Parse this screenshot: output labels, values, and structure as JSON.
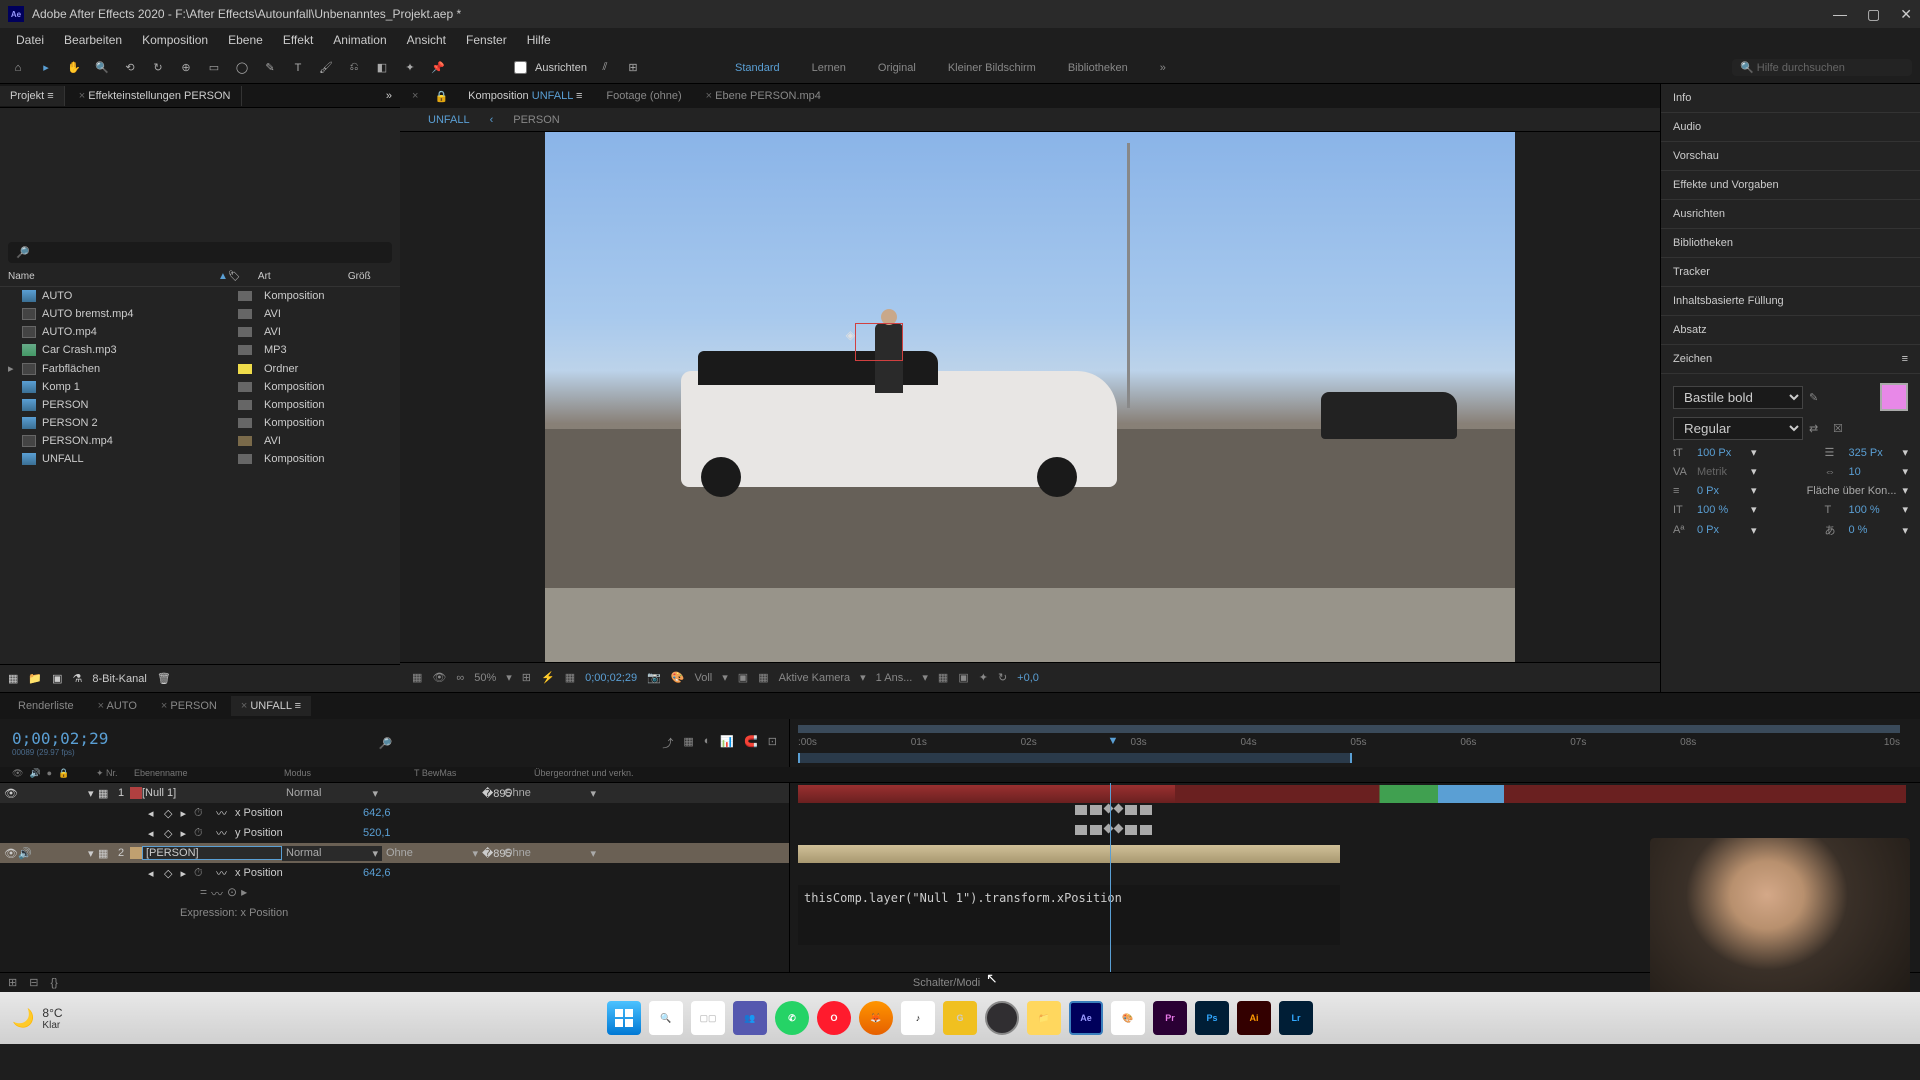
{
  "window": {
    "title": "Adobe After Effects 2020 - F:\\After Effects\\Autounfall\\Unbenanntes_Projekt.aep *"
  },
  "menu": [
    "Datei",
    "Bearbeiten",
    "Komposition",
    "Ebene",
    "Effekt",
    "Animation",
    "Ansicht",
    "Fenster",
    "Hilfe"
  ],
  "toolbar": {
    "align": "Ausrichten",
    "workspaces": [
      "Standard",
      "Lernen",
      "Original",
      "Kleiner Bildschirm",
      "Bibliotheken"
    ],
    "help_placeholder": "Hilfe durchsuchen"
  },
  "project": {
    "tab": "Projekt",
    "effect_tab": "Effekteinstellungen PERSON",
    "cols": {
      "name": "Name",
      "art": "Art",
      "size": "Größ"
    },
    "items": [
      {
        "name": "AUTO",
        "type": "Komposition",
        "swatch": "s3",
        "icon": "comp"
      },
      {
        "name": "AUTO bremst.mp4",
        "type": "AVI",
        "swatch": "s3",
        "icon": "avi"
      },
      {
        "name": "AUTO.mp4",
        "type": "AVI",
        "swatch": "s3",
        "icon": "avi"
      },
      {
        "name": "Car Crash.mp3",
        "type": "MP3",
        "swatch": "s3",
        "icon": "mp3"
      },
      {
        "name": "Farbflächen",
        "type": "Ordner",
        "swatch": "s2",
        "icon": "avi",
        "arrow": true
      },
      {
        "name": "Komp 1",
        "type": "Komposition",
        "swatch": "s3",
        "icon": "comp"
      },
      {
        "name": "PERSON",
        "type": "Komposition",
        "swatch": "s3",
        "icon": "comp"
      },
      {
        "name": "PERSON 2",
        "type": "Komposition",
        "swatch": "s3",
        "icon": "comp"
      },
      {
        "name": "PERSON.mp4",
        "type": "AVI",
        "swatch": "s1",
        "icon": "avi"
      },
      {
        "name": "UNFALL",
        "type": "Komposition",
        "swatch": "s3",
        "icon": "comp"
      }
    ],
    "footer": "8-Bit-Kanal"
  },
  "comp": {
    "tabs": {
      "comp_prefix": "Komposition",
      "comp_name": "UNFALL",
      "footage": "Footage (ohne)",
      "layer": "Ebene PERSON.mp4"
    },
    "breadcrumb": [
      "UNFALL",
      "PERSON"
    ],
    "zoom": "50%",
    "timecode": "0;00;02;29",
    "resolution": "Voll",
    "camera": "Aktive Kamera",
    "views": "1 Ans...",
    "exposure": "+0,0"
  },
  "right_panels": [
    "Info",
    "Audio",
    "Vorschau",
    "Effekte und Vorgaben",
    "Ausrichten",
    "Bibliotheken",
    "Tracker",
    "Inhaltsbasierte Füllung",
    "Absatz"
  ],
  "character": {
    "title": "Zeichen",
    "font": "Bastile bold",
    "style": "Regular",
    "size": "100 Px",
    "leading": "325 Px",
    "kerning": "Metrik",
    "tracking": "10",
    "stroke": "0 Px",
    "fill_label": "Fläche über Kon...",
    "vscale": "100 %",
    "hscale": "100 %",
    "baseline": "0 Px",
    "tsume": "0 %"
  },
  "timeline": {
    "tabs": [
      "Renderliste",
      "AUTO",
      "PERSON",
      "UNFALL"
    ],
    "timecode": "0;00;02;29",
    "framerate": "00089 (29.97 fps)",
    "ruler": [
      ":00s",
      "01s",
      "02s",
      "03s",
      "04s",
      "05s",
      "06s",
      "07s",
      "08s",
      "",
      "10s"
    ],
    "cols": {
      "num": "Nr.",
      "name": "Ebenenname",
      "mode": "Modus",
      "trkmat": "T BewMas",
      "parent": "Übergeordnet und verkn."
    },
    "layers": [
      {
        "num": "1",
        "name": "[Null 1]",
        "mode": "Normal",
        "parent": "Ohne",
        "swatch": "sw-red",
        "props": [
          {
            "name": "x Position",
            "val": "642,6"
          },
          {
            "name": "y Position",
            "val": "520,1"
          }
        ]
      },
      {
        "num": "2",
        "name": "[PERSON]",
        "mode": "Normal",
        "trkmat": "Ohne",
        "parent": "Ohne",
        "swatch": "sw-tan",
        "selected": true,
        "props": [
          {
            "name": "x Position",
            "val": "642,6",
            "expr": true
          }
        ]
      }
    ],
    "expr_label": "Expression: x Position",
    "expression": "thisComp.layer(\"Null 1\").transform.xPosition",
    "footer": "Schalter/Modi"
  },
  "taskbar": {
    "temp": "8°C",
    "cond": "Klar"
  }
}
